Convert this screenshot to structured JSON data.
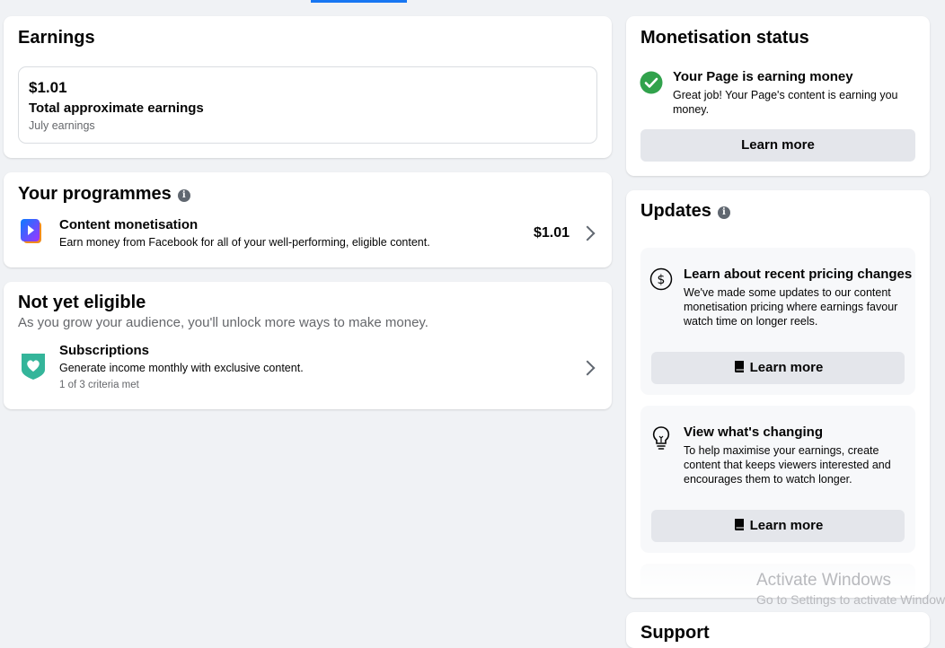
{
  "earnings": {
    "title": "Earnings",
    "amount": "$1.01",
    "label": "Total approximate earnings",
    "period": "July earnings"
  },
  "programmes": {
    "title": "Your programmes",
    "item": {
      "title": "Content monetisation",
      "desc": "Earn money from Facebook for all of your well-performing, eligible content.",
      "amount": "$1.01"
    }
  },
  "not_eligible": {
    "title": "Not yet eligible",
    "subtitle": "As you grow your audience, you'll unlock more ways to make money.",
    "item": {
      "title": "Subscriptions",
      "desc": "Generate income monthly with exclusive content.",
      "criteria": "1 of 3 criteria met"
    }
  },
  "monetisation": {
    "title": "Monetisation status",
    "status_title": "Your Page is earning money",
    "status_desc": "Great job! Your Page's content is earning you money.",
    "button": "Learn more"
  },
  "updates": {
    "title": "Updates",
    "items": [
      {
        "title": "Learn about recent pricing changes",
        "desc": "We've made some updates to our content monetisation pricing where earnings favour watch time on longer reels.",
        "button": "Learn more"
      },
      {
        "title": "View what's changing",
        "desc": "To help maximise your earnings, create content that keeps viewers interested and encourages them to watch longer.",
        "button": "Learn more"
      }
    ]
  },
  "support": {
    "title": "Support"
  },
  "watermark": {
    "line1": "Activate Windows",
    "line2": "Go to Settings to activate Windows."
  },
  "colors": {
    "accent": "#1877f2",
    "success": "#31a24c",
    "subscriptions": "#34b59a"
  }
}
